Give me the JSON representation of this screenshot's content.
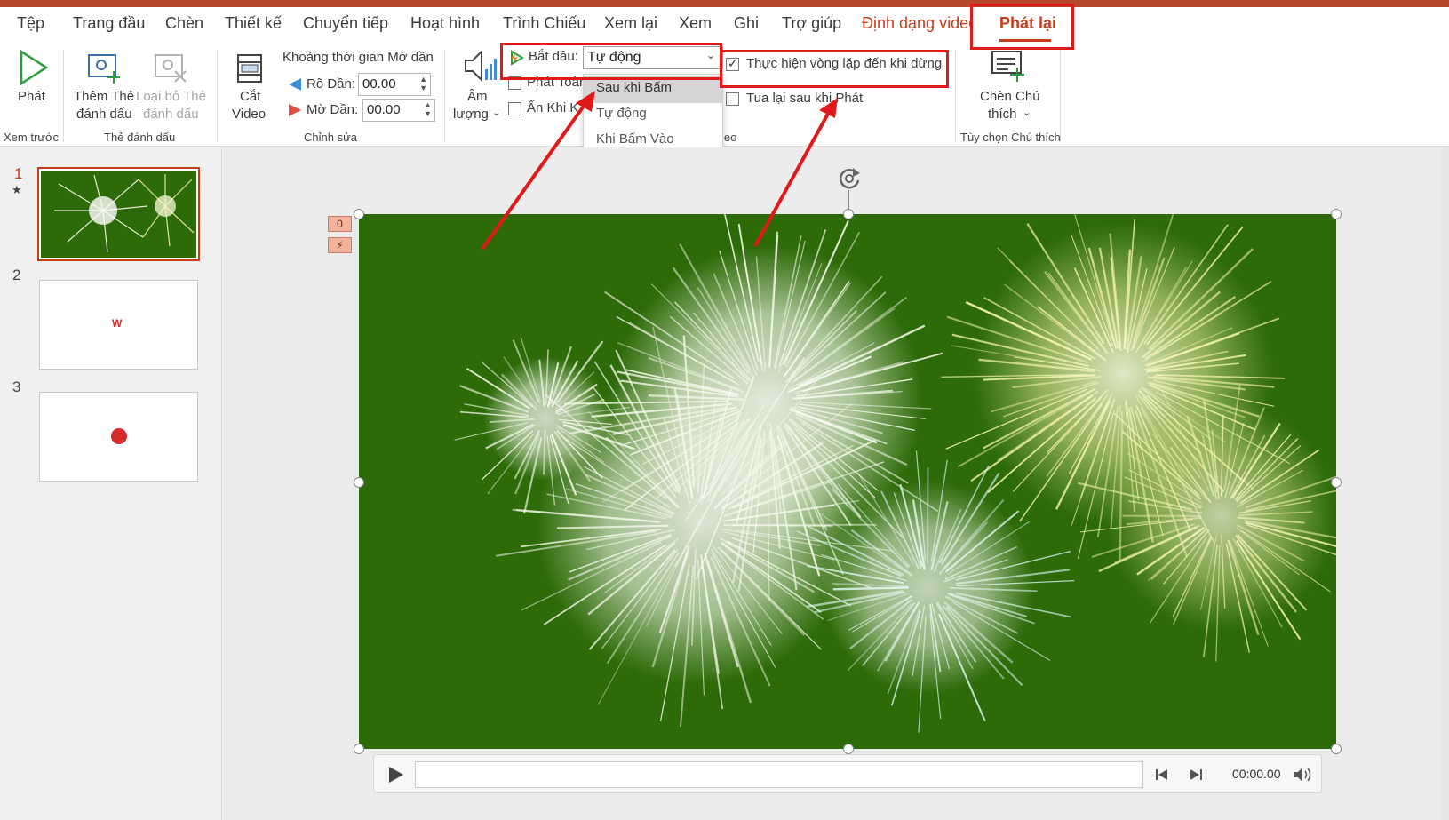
{
  "tabs": [
    "Tệp",
    "Trang đầu",
    "Chèn",
    "Thiết kế",
    "Chuyển tiếp",
    "Hoạt hình",
    "Trình Chiếu",
    "Xem lại",
    "Xem",
    "Ghi",
    "Trợ giúp",
    "Định dạng video",
    "Phát lại"
  ],
  "ribbon": {
    "preview": {
      "play": "Phát",
      "group": "Xem trước"
    },
    "bookmarks": {
      "add_1": "Thêm Thẻ",
      "add_2": "đánh dấu",
      "remove_1": "Loại bỏ Thẻ",
      "remove_2": "đánh dấu",
      "group": "Thẻ đánh dấu"
    },
    "editing": {
      "trim_1": "Cắt",
      "trim_2": "Video",
      "fade_title": "Khoảng thời gian Mờ dần",
      "fade_in_label": "Rõ Dần:",
      "fade_in_value": "00.00",
      "fade_out_label": "Mờ Dần:",
      "fade_out_value": "00.00",
      "group": "Chỉnh sửa"
    },
    "video_options": {
      "volume_1": "Âm",
      "volume_2": "lượng",
      "start_label": "Bắt đầu:",
      "start_value": "Tự động",
      "fullscreen": "Phát Toàn",
      "hide": "Ẩn Khi K",
      "loop": "Thực hiện vòng lặp đến khi dừng",
      "rewind": "Tua lại sau khi Phát",
      "group_tail": "leo",
      "dropdown": [
        "Sau khi Bấm",
        "Tự động",
        "Khi Bấm Vào"
      ]
    },
    "captions": {
      "insert_1": "Chèn Chú",
      "insert_2": "thích",
      "group": "Tùy chọn Chú thích"
    }
  },
  "slides": [
    {
      "number": "1",
      "mark": "★"
    },
    {
      "number": "2"
    },
    {
      "number": "3"
    }
  ],
  "animation_badges": [
    "0",
    "⚡"
  ],
  "player": {
    "time": "00:00.00"
  },
  "colors": {
    "accent": "#c43e1c",
    "highlight_box": "#e0191a",
    "video_bg": "#2d6a08"
  }
}
